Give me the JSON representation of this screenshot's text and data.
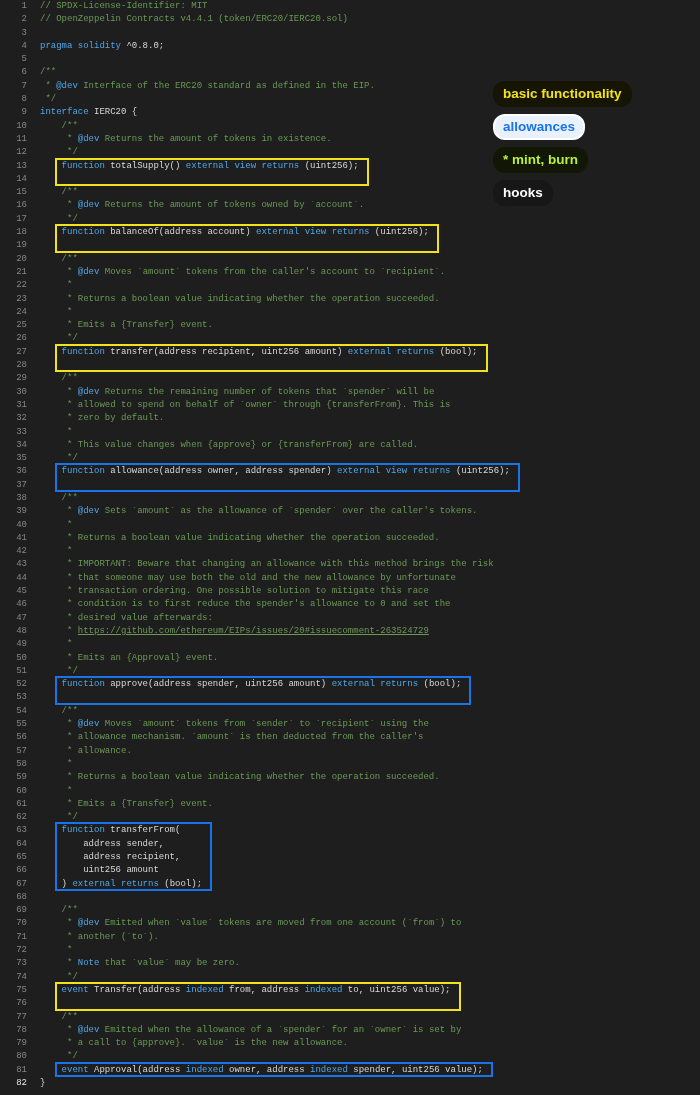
{
  "legend": [
    {
      "label": "basic functionality",
      "color": "#f2e21a",
      "kind": "tinted"
    },
    {
      "label": "allowances",
      "color": "#1a73e8",
      "kind": "filled"
    },
    {
      "label": "* mint, burn",
      "color": "#b8f03a",
      "kind": "tinted"
    },
    {
      "label": "hooks",
      "color": "#ffffff",
      "kind": "tinted"
    }
  ],
  "blocks": [
    {
      "lines": [
        {
          "n": "1",
          "code": [
            {
              "kind": "comment",
              "t": "// SPDX-License-Identifier: MIT"
            }
          ]
        },
        {
          "n": "2",
          "code": [
            {
              "kind": "comment",
              "t": "// OpenZeppelin Contracts v4.4.1 (token/ERC20/IERC20.sol)"
            }
          ]
        },
        {
          "n": "3"
        },
        {
          "n": "4",
          "code": [
            {
              "kind": "keyword",
              "t": "pragma solidity"
            },
            {
              "kind": "plain",
              "t": " ^0.8.0;"
            }
          ]
        },
        {
          "n": "5"
        },
        {
          "n": "6",
          "code": [
            {
              "kind": "comment",
              "t": "/**"
            }
          ]
        },
        {
          "n": "7",
          "code": [
            {
              "kind": "comment",
              "t": " * "
            },
            {
              "kind": "keyword",
              "t": "@dev"
            },
            {
              "kind": "comment",
              "t": " Interface of the ERC20 standard as defined in the EIP."
            }
          ]
        },
        {
          "n": "8",
          "code": [
            {
              "kind": "comment",
              "t": " */"
            }
          ]
        },
        {
          "n": "9",
          "code": [
            {
              "kind": "keyword",
              "t": "interface"
            },
            {
              "kind": "plain",
              "t": " IERC20 {"
            }
          ]
        },
        {
          "n": "10",
          "code": [
            {
              "kind": "comment",
              "t": "    /**"
            }
          ]
        },
        {
          "n": "11",
          "code": [
            {
              "kind": "comment",
              "t": "     * "
            },
            {
              "kind": "keyword",
              "t": "@dev"
            },
            {
              "kind": "comment",
              "t": " Returns the amount of tokens in existence."
            }
          ]
        },
        {
          "n": "12",
          "code": [
            {
              "kind": "comment",
              "t": "     */"
            }
          ]
        }
      ]
    },
    {
      "color": "#f2e21a",
      "lines": [
        {
          "n": "13",
          "code": [
            {
              "kind": "keyword",
              "t": "    function"
            },
            {
              "kind": "plain",
              "t": " totalSupply() "
            },
            {
              "kind": "keyword",
              "t": "external view returns"
            },
            {
              "kind": "plain",
              "t": " (uint256);"
            }
          ]
        },
        {
          "n": "14"
        }
      ]
    },
    {
      "lines": [
        {
          "n": "15",
          "code": [
            {
              "kind": "comment",
              "t": "    /**"
            }
          ]
        },
        {
          "n": "16",
          "code": [
            {
              "kind": "comment",
              "t": "     * "
            },
            {
              "kind": "keyword",
              "t": "@dev"
            },
            {
              "kind": "comment",
              "t": " Returns the amount of tokens owned by `account`."
            }
          ]
        },
        {
          "n": "17",
          "code": [
            {
              "kind": "comment",
              "t": "     */"
            }
          ]
        }
      ]
    },
    {
      "color": "#f2e21a",
      "lines": [
        {
          "n": "18",
          "code": [
            {
              "kind": "keyword",
              "t": "    function"
            },
            {
              "kind": "plain",
              "t": " balanceOf(address account) "
            },
            {
              "kind": "keyword",
              "t": "external view returns"
            },
            {
              "kind": "plain",
              "t": " (uint256);"
            }
          ]
        },
        {
          "n": "19"
        }
      ]
    },
    {
      "lines": [
        {
          "n": "20",
          "code": [
            {
              "kind": "comment",
              "t": "    /**"
            }
          ]
        },
        {
          "n": "21",
          "code": [
            {
              "kind": "comment",
              "t": "     * "
            },
            {
              "kind": "keyword",
              "t": "@dev"
            },
            {
              "kind": "comment",
              "t": " Moves `amount` tokens from the caller's account to `recipient`."
            }
          ]
        },
        {
          "n": "22",
          "code": [
            {
              "kind": "comment",
              "t": "     *"
            }
          ]
        },
        {
          "n": "23",
          "code": [
            {
              "kind": "comment",
              "t": "     * Returns a boolean value indicating whether the operation succeeded."
            }
          ]
        },
        {
          "n": "24",
          "code": [
            {
              "kind": "comment",
              "t": "     *"
            }
          ]
        },
        {
          "n": "25",
          "code": [
            {
              "kind": "comment",
              "t": "     * Emits a {Transfer} event."
            }
          ]
        },
        {
          "n": "26",
          "code": [
            {
              "kind": "comment",
              "t": "     */"
            }
          ]
        }
      ]
    },
    {
      "color": "#f2e21a",
      "lines": [
        {
          "n": "27",
          "code": [
            {
              "kind": "keyword",
              "t": "    function"
            },
            {
              "kind": "plain",
              "t": " transfer(address recipient, uint256 amount) "
            },
            {
              "kind": "keyword",
              "t": "external returns"
            },
            {
              "kind": "plain",
              "t": " (bool);"
            }
          ]
        },
        {
          "n": "28"
        }
      ]
    },
    {
      "lines": [
        {
          "n": "29",
          "code": [
            {
              "kind": "comment",
              "t": "    /**"
            }
          ]
        },
        {
          "n": "30",
          "code": [
            {
              "kind": "comment",
              "t": "     * "
            },
            {
              "kind": "keyword",
              "t": "@dev"
            },
            {
              "kind": "comment",
              "t": " Returns the remaining number of tokens that `spender` will be"
            }
          ]
        },
        {
          "n": "31",
          "code": [
            {
              "kind": "comment",
              "t": "     * allowed to spend on behalf of `owner` through {transferFrom}. This is"
            }
          ]
        },
        {
          "n": "32",
          "code": [
            {
              "kind": "comment",
              "t": "     * zero by default."
            }
          ]
        },
        {
          "n": "33",
          "code": [
            {
              "kind": "comment",
              "t": "     *"
            }
          ]
        },
        {
          "n": "34",
          "code": [
            {
              "kind": "comment",
              "t": "     * This value changes when {approve} or {transferFrom} are called."
            }
          ]
        },
        {
          "n": "35",
          "code": [
            {
              "kind": "comment",
              "t": "     */"
            }
          ]
        }
      ]
    },
    {
      "color": "#1a73e8",
      "lines": [
        {
          "n": "36",
          "code": [
            {
              "kind": "keyword",
              "t": "    function"
            },
            {
              "kind": "plain",
              "t": " allowance(address owner, address spender) "
            },
            {
              "kind": "keyword",
              "t": "external view returns"
            },
            {
              "kind": "plain",
              "t": " (uint256);"
            }
          ]
        },
        {
          "n": "37"
        }
      ]
    },
    {
      "lines": [
        {
          "n": "38",
          "code": [
            {
              "kind": "comment",
              "t": "    /**"
            }
          ]
        },
        {
          "n": "39",
          "code": [
            {
              "kind": "comment",
              "t": "     * "
            },
            {
              "kind": "keyword",
              "t": "@dev"
            },
            {
              "kind": "comment",
              "t": " Sets `amount` as the allowance of `spender` over the caller's tokens."
            }
          ]
        },
        {
          "n": "40",
          "code": [
            {
              "kind": "comment",
              "t": "     *"
            }
          ]
        },
        {
          "n": "41",
          "code": [
            {
              "kind": "comment",
              "t": "     * Returns a boolean value indicating whether the operation succeeded."
            }
          ]
        },
        {
          "n": "42",
          "code": [
            {
              "kind": "comment",
              "t": "     *"
            }
          ]
        },
        {
          "n": "43",
          "code": [
            {
              "kind": "comment",
              "t": "     * IMPORTANT: Beware that changing an allowance with this method brings the risk"
            }
          ]
        },
        {
          "n": "44",
          "code": [
            {
              "kind": "comment",
              "t": "     * that someone may use both the old and the new allowance by unfortunate"
            }
          ]
        },
        {
          "n": "45",
          "code": [
            {
              "kind": "comment",
              "t": "     * transaction ordering. One possible solution to mitigate this race"
            }
          ]
        },
        {
          "n": "46",
          "code": [
            {
              "kind": "comment",
              "t": "     * condition is to first reduce the spender's allowance to 0 and set the"
            }
          ]
        },
        {
          "n": "47",
          "code": [
            {
              "kind": "comment",
              "t": "     * desired value afterwards:"
            }
          ]
        },
        {
          "n": "48",
          "code": [
            {
              "kind": "comment",
              "t": "     * "
            },
            {
              "kind": "link",
              "t": "https://github.com/ethereum/EIPs/issues/20#issuecomment-263524729"
            }
          ]
        },
        {
          "n": "49",
          "code": [
            {
              "kind": "comment",
              "t": "     *"
            }
          ]
        },
        {
          "n": "50",
          "code": [
            {
              "kind": "comment",
              "t": "     * Emits an {Approval} event."
            }
          ]
        },
        {
          "n": "51",
          "code": [
            {
              "kind": "comment",
              "t": "     */"
            }
          ]
        }
      ]
    },
    {
      "color": "#1a73e8",
      "lines": [
        {
          "n": "52",
          "code": [
            {
              "kind": "keyword",
              "t": "    function"
            },
            {
              "kind": "plain",
              "t": " approve(address spender, uint256 amount) "
            },
            {
              "kind": "keyword",
              "t": "external returns"
            },
            {
              "kind": "plain",
              "t": " (bool);"
            }
          ]
        },
        {
          "n": "53"
        }
      ]
    },
    {
      "lines": [
        {
          "n": "54",
          "code": [
            {
              "kind": "comment",
              "t": "    /**"
            }
          ]
        },
        {
          "n": "55",
          "code": [
            {
              "kind": "comment",
              "t": "     * "
            },
            {
              "kind": "keyword",
              "t": "@dev"
            },
            {
              "kind": "comment",
              "t": " Moves `amount` tokens from `sender` to `recipient` using the"
            }
          ]
        },
        {
          "n": "56",
          "code": [
            {
              "kind": "comment",
              "t": "     * allowance mechanism. `amount` is then deducted from the caller's"
            }
          ]
        },
        {
          "n": "57",
          "code": [
            {
              "kind": "comment",
              "t": "     * allowance."
            }
          ]
        },
        {
          "n": "58",
          "code": [
            {
              "kind": "comment",
              "t": "     *"
            }
          ]
        },
        {
          "n": "59",
          "code": [
            {
              "kind": "comment",
              "t": "     * Returns a boolean value indicating whether the operation succeeded."
            }
          ]
        },
        {
          "n": "60",
          "code": [
            {
              "kind": "comment",
              "t": "     *"
            }
          ]
        },
        {
          "n": "61",
          "code": [
            {
              "kind": "comment",
              "t": "     * Emits a {Transfer} event."
            }
          ]
        },
        {
          "n": "62",
          "code": [
            {
              "kind": "comment",
              "t": "     */"
            }
          ]
        }
      ]
    },
    {
      "color": "#1a73e8",
      "lines": [
        {
          "n": "63",
          "code": [
            {
              "kind": "keyword",
              "t": "    function"
            },
            {
              "kind": "plain",
              "t": " transferFrom("
            }
          ]
        },
        {
          "n": "64",
          "code": [
            {
              "kind": "plain",
              "t": "        address sender,"
            }
          ]
        },
        {
          "n": "65",
          "code": [
            {
              "kind": "plain",
              "t": "        address recipient,"
            }
          ]
        },
        {
          "n": "66",
          "code": [
            {
              "kind": "plain",
              "t": "        uint256 amount"
            }
          ]
        },
        {
          "n": "67",
          "code": [
            {
              "kind": "plain",
              "t": "    ) "
            },
            {
              "kind": "keyword",
              "t": "external returns"
            },
            {
              "kind": "plain",
              "t": " (bool);"
            }
          ]
        }
      ]
    },
    {
      "lines": [
        {
          "n": "68"
        },
        {
          "n": "69",
          "code": [
            {
              "kind": "comment",
              "t": "    /**"
            }
          ]
        },
        {
          "n": "70",
          "code": [
            {
              "kind": "comment",
              "t": "     * "
            },
            {
              "kind": "keyword",
              "t": "@dev"
            },
            {
              "kind": "comment",
              "t": " Emitted when `value` tokens are moved from one account (`from`) to"
            }
          ]
        },
        {
          "n": "71",
          "code": [
            {
              "kind": "comment",
              "t": "     * another (`to`)."
            }
          ]
        },
        {
          "n": "72",
          "code": [
            {
              "kind": "comment",
              "t": "     *"
            }
          ]
        },
        {
          "n": "73",
          "code": [
            {
              "kind": "comment",
              "t": "     * "
            },
            {
              "kind": "keyword",
              "t": "Note"
            },
            {
              "kind": "comment",
              "t": " that `value` may be zero."
            }
          ]
        },
        {
          "n": "74",
          "code": [
            {
              "kind": "comment",
              "t": "     */"
            }
          ]
        }
      ]
    },
    {
      "color": "#f2e21a",
      "lines": [
        {
          "n": "75",
          "code": [
            {
              "kind": "keyword",
              "t": "    event"
            },
            {
              "kind": "plain",
              "t": " Transfer(address "
            },
            {
              "kind": "keyword",
              "t": "indexed"
            },
            {
              "kind": "plain",
              "t": " from, address "
            },
            {
              "kind": "keyword",
              "t": "indexed"
            },
            {
              "kind": "plain",
              "t": " to, uint256 value);"
            }
          ]
        },
        {
          "n": "76"
        }
      ]
    },
    {
      "lines": [
        {
          "n": "77",
          "code": [
            {
              "kind": "comment",
              "t": "    /**"
            }
          ]
        },
        {
          "n": "78",
          "code": [
            {
              "kind": "comment",
              "t": "     * "
            },
            {
              "kind": "keyword",
              "t": "@dev"
            },
            {
              "kind": "comment",
              "t": " Emitted when the allowance of a `spender` for an `owner` is set by"
            }
          ]
        },
        {
          "n": "79",
          "code": [
            {
              "kind": "comment",
              "t": "     * a call to {approve}. `value` is the new allowance."
            }
          ]
        },
        {
          "n": "80",
          "code": [
            {
              "kind": "comment",
              "t": "     */"
            }
          ]
        }
      ]
    },
    {
      "color": "#1a73e8",
      "lines": [
        {
          "n": "81",
          "code": [
            {
              "kind": "keyword",
              "t": "    event"
            },
            {
              "kind": "plain",
              "t": " Approval(address "
            },
            {
              "kind": "keyword",
              "t": "indexed"
            },
            {
              "kind": "plain",
              "t": " owner, address "
            },
            {
              "kind": "keyword",
              "t": "indexed"
            },
            {
              "kind": "plain",
              "t": " spender, uint256 value);"
            }
          ]
        }
      ]
    },
    {
      "lines": [
        {
          "n": "82",
          "current": true,
          "code": [
            {
              "kind": "plain",
              "t": "}"
            }
          ]
        }
      ]
    }
  ]
}
